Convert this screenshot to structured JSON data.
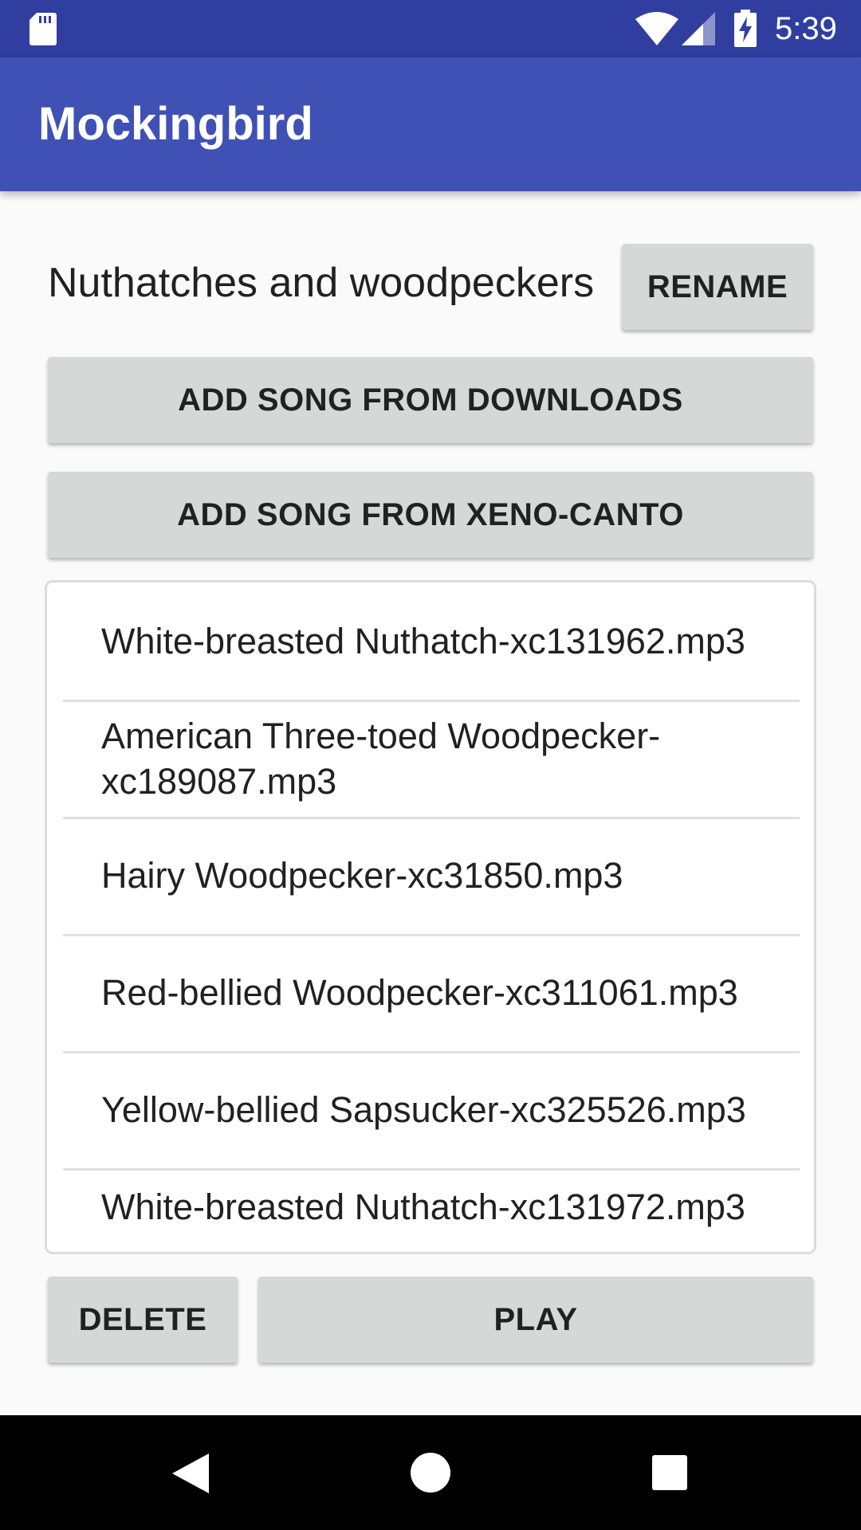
{
  "status_bar": {
    "time": "5:39",
    "icons": [
      "sd-card-icon",
      "wifi-icon",
      "cell-signal-icon",
      "battery-charging-icon"
    ]
  },
  "app_bar": {
    "title": "Mockingbird"
  },
  "playlist": {
    "name": "Nuthatches and woodpeckers",
    "rename_label": "RENAME",
    "add_downloads_label": "ADD SONG FROM DOWNLOADS",
    "add_xeno_label": "ADD SONG FROM XENO-CANTO"
  },
  "songs": [
    "White-breasted Nuthatch-xc131962.mp3",
    "American Three-toed Woodpecker-xc189087.mp3",
    "Hairy Woodpecker-xc31850.mp3",
    "Red-bellied Woodpecker-xc311061.mp3",
    "Yellow-bellied Sapsucker-xc325526.mp3",
    "White-breasted Nuthatch-xc131972.mp3"
  ],
  "actions": {
    "delete_label": "DELETE",
    "play_label": "PLAY"
  },
  "nav_bar": {
    "icons": [
      "back-icon",
      "home-icon",
      "recent-apps-icon"
    ]
  },
  "colors": {
    "status_bar": "#303f9f",
    "app_bar": "#3f51b5",
    "button": "#d6d7d7",
    "nav_bar": "#000000"
  }
}
